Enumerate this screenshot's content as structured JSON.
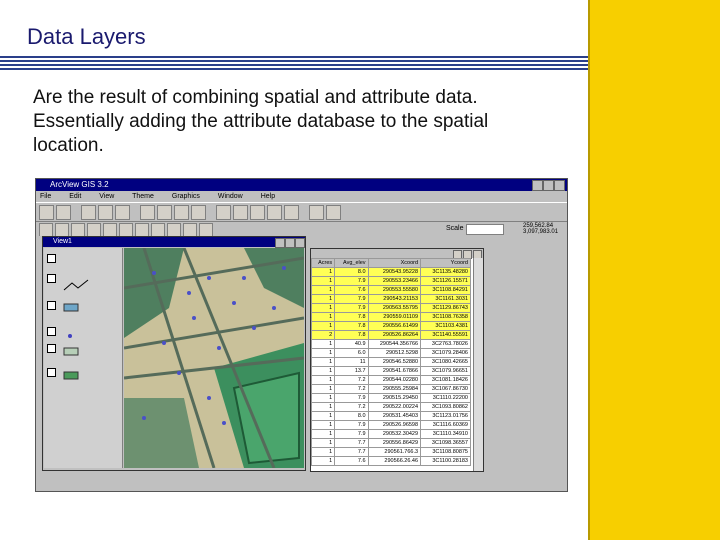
{
  "slide": {
    "title": "Data Layers",
    "body_line1": "Are the result of combining spatial and attribute data.",
    "body_line2": "Essentially adding the attribute database to the spatial",
    "body_line3": "location."
  },
  "colors": {
    "accent": "#f7cf00",
    "title_text": "#1a1a6e",
    "rule": "#2a3f8a",
    "selected_row": "#ffff55"
  },
  "screenshot": {
    "app_title": "ArcView GIS 3.2",
    "menu": [
      "File",
      "Edit",
      "View",
      "Theme",
      "Graphics",
      "Window",
      "Help"
    ],
    "scale_label": "Scale 1:",
    "coord_line1": "259,562.84",
    "coord_line2": "3,097,983.01",
    "view_title": "View1",
    "table": {
      "headers": [
        "Acres",
        "Avg_elev",
        "Xcoord",
        "Ycoord"
      ],
      "rows": [
        [
          "1",
          "8.0",
          "290543.95228",
          "3C1135.48280"
        ],
        [
          "1",
          "7.9",
          "290553.23466",
          "3C1126.15571"
        ],
        [
          "1",
          "7.6",
          "290553.55580",
          "3C1108.84291"
        ],
        [
          "1",
          "7.9",
          "290543.21153",
          "3C1161.3031"
        ],
        [
          "1",
          "7.9",
          "290563.55795",
          "3C1129.86743"
        ],
        [
          "1",
          "7.8",
          "290559.01109",
          "3C1108.76358"
        ],
        [
          "1",
          "7.8",
          "290556.61499",
          "3C1103.4381"
        ],
        [
          "2",
          "7.8",
          "290526.86264",
          "3C1140.55591"
        ],
        [
          "1",
          "40.9",
          "290544.356766",
          "3C2763.78026"
        ],
        [
          "1",
          "6.0",
          "290512.5298",
          "3C1079.28406"
        ],
        [
          "1",
          "11",
          "290546.52880",
          "3C1080.42665"
        ],
        [
          "1",
          "13.7",
          "290541.67866",
          "3C1079.96651"
        ],
        [
          "1",
          "7.2",
          "290544.02280",
          "3C1081.18426"
        ],
        [
          "1",
          "7.2",
          "290555.25984",
          "3C1067.86730"
        ],
        [
          "1",
          "7.9",
          "290515.29450",
          "3C1110.22200"
        ],
        [
          "1",
          "7.2",
          "290522.00224",
          "3C1093.80862"
        ],
        [
          "1",
          "8.0",
          "290531.45403",
          "3C1123.01756"
        ],
        [
          "1",
          "7.9",
          "290526.96598",
          "3C1116.60369"
        ],
        [
          "1",
          "7.9",
          "290532.30429",
          "3C1110.34910"
        ],
        [
          "1",
          "7.7",
          "290556.86429",
          "3C1098.36557"
        ],
        [
          "1",
          "7.7",
          "290561.766.3",
          "3C1108.80875"
        ],
        [
          "1",
          "7.6",
          "290566.26.46",
          "3C1100.28183"
        ]
      ]
    },
    "selected_rows": 8
  }
}
